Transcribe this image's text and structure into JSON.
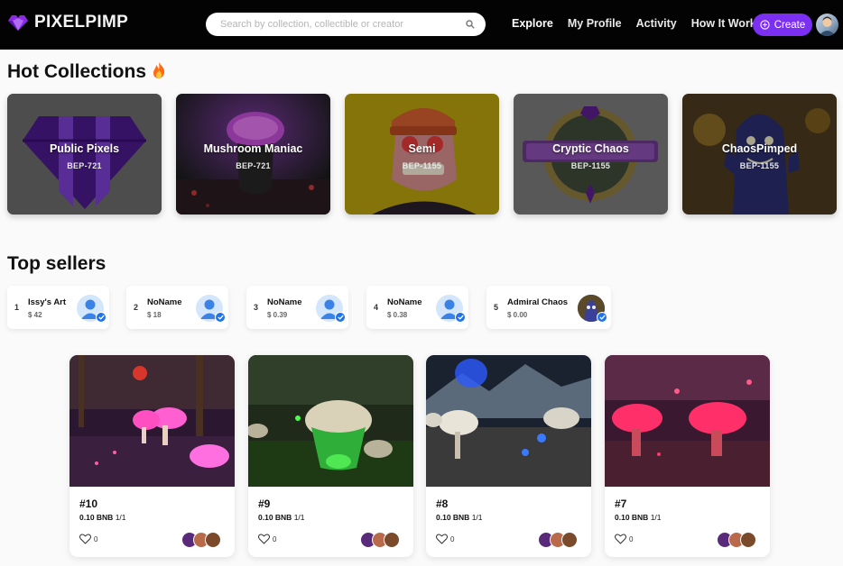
{
  "brand": {
    "name": "PIXELPIMP",
    "accent": "#7b2ff2"
  },
  "search": {
    "placeholder": "Search by collection, collectible or creator",
    "icon": "search-icon"
  },
  "nav": {
    "explore": "Explore",
    "profile": "My Profile",
    "activity": "Activity",
    "how": "How It Work"
  },
  "create_label": "Create",
  "hot": {
    "title": "Hot Collections",
    "items": [
      {
        "name": "Public Pixels",
        "standard": "BEP-721"
      },
      {
        "name": "Mushroom Maniac",
        "standard": "BEP-721"
      },
      {
        "name": "Semi",
        "standard": "BEP-1155"
      },
      {
        "name": "Cryptic Chaos",
        "standard": "BEP-1155"
      },
      {
        "name": "ChaosPimped",
        "standard": "BEP-1155"
      }
    ]
  },
  "sellers": {
    "title": "Top sellers",
    "items": [
      {
        "rank": "1",
        "name": "Issy's Art",
        "amount": "$ 42"
      },
      {
        "rank": "2",
        "name": "NoName",
        "amount": "$ 18"
      },
      {
        "rank": "3",
        "name": "NoName",
        "amount": "$ 0.39"
      },
      {
        "rank": "4",
        "name": "NoName",
        "amount": "$ 0.38"
      },
      {
        "rank": "5",
        "name": "Admiral Chaos",
        "amount": "$ 0.00"
      }
    ]
  },
  "cards": [
    {
      "title": "#10",
      "price": "0.10 BNB",
      "edition": "1/1",
      "likes": "0"
    },
    {
      "title": "#9",
      "price": "0.10 BNB",
      "edition": "1/1",
      "likes": "0"
    },
    {
      "title": "#8",
      "price": "0.10 BNB",
      "edition": "1/1",
      "likes": "0"
    },
    {
      "title": "#7",
      "price": "0.10 BNB",
      "edition": "1/1",
      "likes": "0"
    }
  ]
}
